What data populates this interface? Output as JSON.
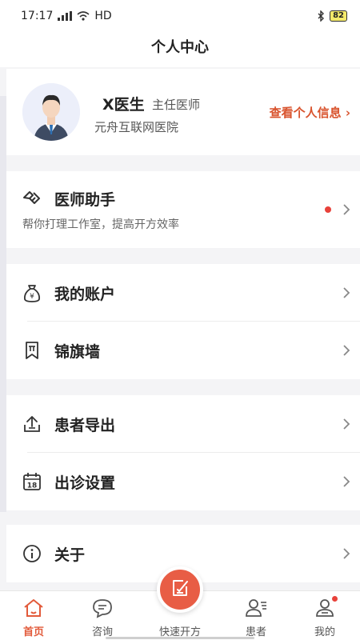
{
  "status_bar": {
    "time": "17:17",
    "network": "HD",
    "battery": "82"
  },
  "header": {
    "title": "个人中心"
  },
  "profile": {
    "name": "X医生",
    "title": "主任医师",
    "hospital": "元舟互联网医院",
    "view_info": "查看个人信息 ›"
  },
  "assistant": {
    "title": "医师助手",
    "subtitle": "帮你打理工作室，提高开方效率",
    "icon": "handshake-icon"
  },
  "menu": [
    {
      "label": "我的账户",
      "icon": "money-bag-icon"
    },
    {
      "label": "锦旗墙",
      "icon": "banner-icon"
    },
    {
      "label": "患者导出",
      "icon": "export-icon"
    },
    {
      "label": "出诊设置",
      "icon": "calendar-icon",
      "calendar_day": "18"
    },
    {
      "label": "关于",
      "icon": "info-icon"
    }
  ],
  "tabbar": {
    "items": [
      {
        "label": "首页",
        "icon": "home-icon",
        "active": true
      },
      {
        "label": "咨询",
        "icon": "chat-icon"
      },
      {
        "label": "快速开方",
        "icon": "prescription-icon"
      },
      {
        "label": "患者",
        "icon": "patients-icon"
      },
      {
        "label": "我的",
        "icon": "profile-icon"
      }
    ]
  },
  "colors": {
    "accent": "#e85d45",
    "link": "#d9542e",
    "badge": "#e8413a"
  }
}
